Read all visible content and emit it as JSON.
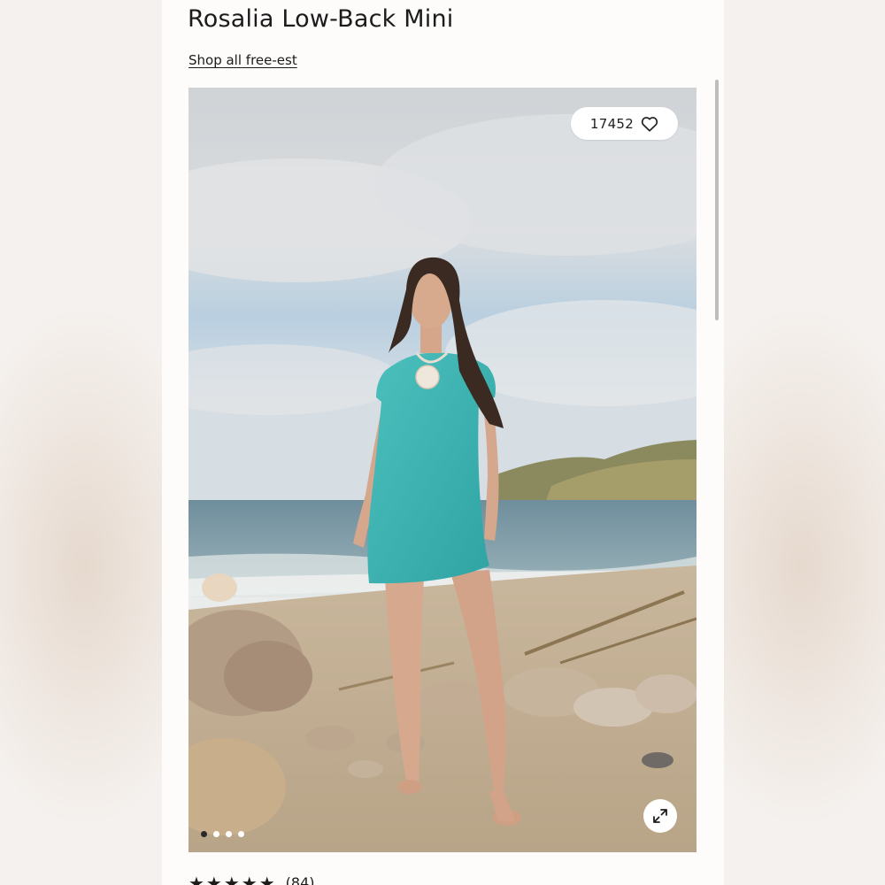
{
  "product": {
    "title": "Rosalia Low-Back Mini",
    "shop_link_label": "Shop all free-est"
  },
  "gallery": {
    "likes_count": "17452",
    "heart_icon": "heart-icon",
    "expand_icon": "expand-icon",
    "slide_count": 4,
    "active_slide": 1
  },
  "rating": {
    "stars_glyph": "★★★★★",
    "review_count": "(84)"
  },
  "colors": {
    "dress": "#3fb3b1",
    "page_background": "#f5f1ee"
  }
}
